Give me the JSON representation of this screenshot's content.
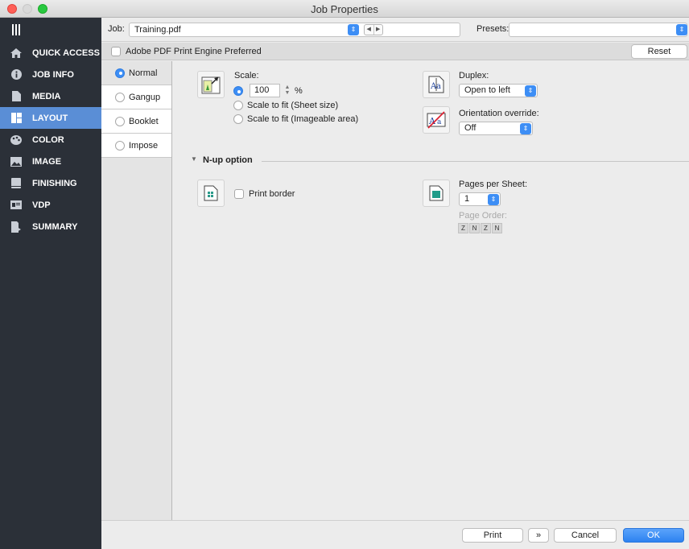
{
  "window": {
    "title": "Job Properties"
  },
  "nav": {
    "items": [
      {
        "label": "",
        "icon": "menu-icon"
      },
      {
        "label": "QUICK ACCESS",
        "icon": "home-icon"
      },
      {
        "label": "JOB INFO",
        "icon": "info-icon"
      },
      {
        "label": "MEDIA",
        "icon": "document-icon"
      },
      {
        "label": "LAYOUT",
        "icon": "layout-icon"
      },
      {
        "label": "COLOR",
        "icon": "palette-icon"
      },
      {
        "label": "IMAGE",
        "icon": "image-icon"
      },
      {
        "label": "FINISHING",
        "icon": "finishing-icon"
      },
      {
        "label": "VDP",
        "icon": "vdp-icon"
      },
      {
        "label": "SUMMARY",
        "icon": "summary-icon"
      }
    ],
    "active_color": "#5a8ed6"
  },
  "jobbar": {
    "job_label": "Job:",
    "job_value": "Training.pdf",
    "presets_label": "Presets:",
    "presets_value": ""
  },
  "engine": {
    "checkbox_label": "Adobe PDF Print Engine Preferred",
    "reset_label": "Reset"
  },
  "tabs": {
    "normal": "Normal",
    "gangup": "Gangup",
    "booklet": "Booklet",
    "impose": "Impose"
  },
  "scale": {
    "label": "Scale:",
    "value": "100",
    "unit": "%",
    "fit_sheet": "Scale to fit (Sheet size)",
    "fit_imageable": "Scale to fit (Imageable area)"
  },
  "duplex": {
    "label": "Duplex:",
    "value": "Open to left"
  },
  "orientation": {
    "label": "Orientation override:",
    "value": "Off"
  },
  "nup": {
    "title": "N-up option",
    "print_border": "Print border",
    "pages_per_sheet_label": "Pages per Sheet:",
    "pages_per_sheet_value": "1",
    "page_order_label": "Page Order:",
    "page_order_buttons": [
      "Z",
      "N",
      "Z",
      "N"
    ]
  },
  "footer": {
    "print": "Print",
    "more": "»",
    "cancel": "Cancel",
    "ok": "OK"
  },
  "colors": {
    "accent": "#3d8ef5",
    "nav_bg": "#2b3038"
  }
}
